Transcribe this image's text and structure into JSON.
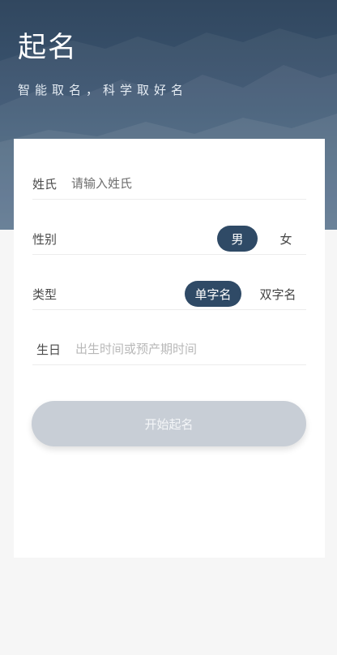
{
  "header": {
    "title": "起名",
    "subtitle": "智能取名，科学取好名"
  },
  "form": {
    "surname": {
      "label": "姓氏",
      "placeholder": "请输入姓氏",
      "value": ""
    },
    "gender": {
      "label": "性别",
      "options": [
        "男",
        "女"
      ],
      "selected": "男"
    },
    "type": {
      "label": "类型",
      "options": [
        "单字名",
        "双字名"
      ],
      "selected": "单字名"
    },
    "birthday": {
      "label": "生日",
      "placeholder": "出生时间或预产期时间",
      "value": ""
    }
  },
  "actions": {
    "start_label": "开始起名"
  },
  "colors": {
    "header_bg": "#3b5571",
    "accent": "#2f4a66",
    "button_disabled": "#c8ced6"
  }
}
